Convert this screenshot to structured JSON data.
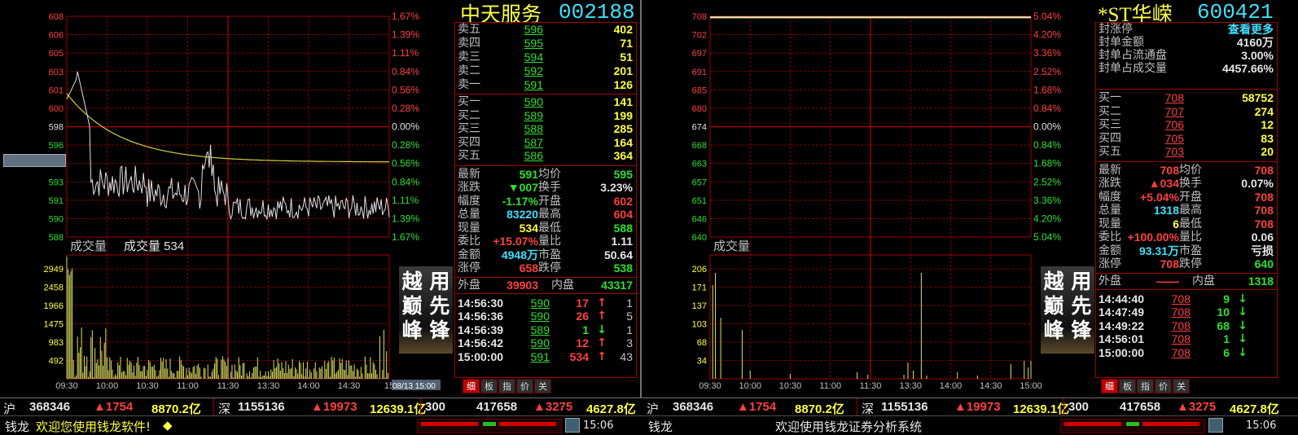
{
  "left": {
    "name": "中天服务",
    "code": "002188",
    "price_axis": [
      "608",
      "606",
      "605",
      "603",
      "601",
      "600",
      "598",
      "596",
      "596",
      "593",
      "591",
      "590",
      "588"
    ],
    "pct_axis": [
      "1.67%",
      "1.39%",
      "1.11%",
      "0.84%",
      "0.56%",
      "0.28%",
      "0.00%",
      "0.28%",
      "0.56%",
      "0.84%",
      "1.11%",
      "1.39%",
      "1.67%"
    ],
    "volume_label": "成交量",
    "volume_text": "成交量 534",
    "vol_axis": [
      "2949",
      "2458",
      "1966",
      "1475",
      "983",
      "492"
    ],
    "time_axis": [
      "09:30",
      "10:00",
      "10:30",
      "11:00",
      "11:30",
      "13:30",
      "14:00",
      "14:30",
      "15"
    ],
    "date_box": "08/13 15:00",
    "sells": [
      {
        "label": "卖五",
        "price": "596",
        "vol": "402"
      },
      {
        "label": "卖四",
        "price": "595",
        "vol": "71"
      },
      {
        "label": "卖三",
        "price": "594",
        "vol": "51"
      },
      {
        "label": "卖二",
        "price": "592",
        "vol": "201"
      },
      {
        "label": "卖一",
        "price": "591",
        "vol": "126"
      }
    ],
    "buys": [
      {
        "label": "买一",
        "price": "590",
        "vol": "141"
      },
      {
        "label": "买二",
        "price": "589",
        "vol": "199"
      },
      {
        "label": "买三",
        "price": "588",
        "vol": "285"
      },
      {
        "label": "买四",
        "price": "587",
        "vol": "164"
      },
      {
        "label": "买五",
        "price": "586",
        "vol": "364"
      }
    ],
    "stats": [
      [
        "最新",
        "591",
        "均价",
        "595"
      ],
      [
        "涨跌",
        "▼007",
        "换手",
        "3.23%"
      ],
      [
        "幅度",
        "-1.17%",
        "开盘",
        "602"
      ],
      [
        "总量",
        "83220",
        "最高",
        "604"
      ],
      [
        "现量",
        "534",
        "最低",
        "588"
      ],
      [
        "委比",
        "+15.07%",
        "量比",
        "1.11"
      ],
      [
        "金额",
        "4948万",
        "市盈",
        "50.64"
      ],
      [
        "涨停",
        "658",
        "跌停",
        "538"
      ]
    ],
    "outer_label": "外盘",
    "outer": "39903",
    "inner_label": "内盘",
    "inner": "43317",
    "ticks": [
      [
        "14:56:30",
        "590",
        "17",
        "↑",
        "1"
      ],
      [
        "14:56:36",
        "590",
        "26",
        "↑",
        "5"
      ],
      [
        "14:56:39",
        "589",
        "1",
        "↓",
        "1"
      ],
      [
        "14:56:42",
        "590",
        "12",
        "↑",
        "3"
      ],
      [
        "15:00:00",
        "591",
        "534",
        "↑",
        "43"
      ]
    ],
    "ad": [
      "越",
      "用",
      "巅",
      "先",
      "峰",
      "锋"
    ],
    "tabs": [
      "细",
      "板",
      "指",
      "价",
      "关"
    ]
  },
  "right": {
    "name": "*ST华嵘",
    "code": "600421",
    "price_axis": [
      "708",
      "702",
      "697",
      "691",
      "685",
      "680",
      "674",
      "668",
      "663",
      "657",
      "651",
      "646",
      "640"
    ],
    "pct_axis": [
      "5.04%",
      "4.20%",
      "3.36%",
      "2.52%",
      "1.68%",
      "0.84%",
      "0.00%",
      "0.84%",
      "1.68%",
      "2.52%",
      "3.36%",
      "4.20%",
      "5.04%"
    ],
    "volume_label": "成交量",
    "vol_axis": [
      "206",
      "171",
      "137",
      "103",
      "68",
      "34"
    ],
    "time_axis": [
      "09:30",
      "10:00",
      "10:30",
      "11:00",
      "11:30",
      "13:30",
      "14:00",
      "14:30",
      "15:00"
    ],
    "limit_info": [
      [
        "封涨停",
        "查看更多"
      ],
      [
        "封单金额",
        "4160万"
      ],
      [
        "封单占流通盘",
        "3.00%"
      ],
      [
        "封单占成交量",
        "4457.66%"
      ]
    ],
    "buys": [
      {
        "label": "买一",
        "price": "708",
        "vol": "58752"
      },
      {
        "label": "买二",
        "price": "707",
        "vol": "274"
      },
      {
        "label": "买三",
        "price": "706",
        "vol": "12"
      },
      {
        "label": "买四",
        "price": "705",
        "vol": "83"
      },
      {
        "label": "买五",
        "price": "703",
        "vol": "20"
      }
    ],
    "stats": [
      [
        "最新",
        "708",
        "均价",
        "708"
      ],
      [
        "涨跌",
        "▲034",
        "换手",
        "0.07%"
      ],
      [
        "幅度",
        "+5.04%",
        "开盘",
        "708"
      ],
      [
        "总量",
        "1318",
        "最高",
        "708"
      ],
      [
        "现量",
        "6",
        "最低",
        "708"
      ],
      [
        "委比",
        "+100.00%",
        "量比",
        "0.06"
      ],
      [
        "金额",
        "93.31万",
        "市盈",
        "亏损"
      ],
      [
        "涨停",
        "708",
        "跌停",
        "640"
      ]
    ],
    "outer_label": "外盘",
    "outer": "——",
    "inner_label": "内盘",
    "inner": "1318",
    "ticks": [
      [
        "14:44:40",
        "708",
        "9",
        "↓"
      ],
      [
        "14:47:49",
        "708",
        "10",
        "↓"
      ],
      [
        "14:49:22",
        "708",
        "68",
        "↓"
      ],
      [
        "14:56:01",
        "708",
        "1",
        "↓"
      ],
      [
        "15:00:00",
        "708",
        "6",
        "↓"
      ]
    ],
    "ad": [
      "越",
      "用",
      "巅",
      "先",
      "峰",
      "锋"
    ],
    "tabs": [
      "细",
      "板",
      "指",
      "价",
      "关"
    ]
  },
  "status": {
    "sh_label": "沪",
    "sh_index": "368346",
    "sh_change": "▲1754",
    "sh_amount": "8870.2亿",
    "sz_label": "深",
    "sz_index": "1155136",
    "sz_change": "▲19973",
    "sz_amount": "12639.1亿",
    "c300_label": "300",
    "c300_index": "417658",
    "c300_change": "▲3275",
    "c300_amount": "4627.8亿"
  },
  "bottom": {
    "app": "钱龙",
    "welcome_left": "欢迎您使用钱龙软件!",
    "welcome_right": "欢迎使用钱龙证券分析系统",
    "time": "15:06"
  }
}
